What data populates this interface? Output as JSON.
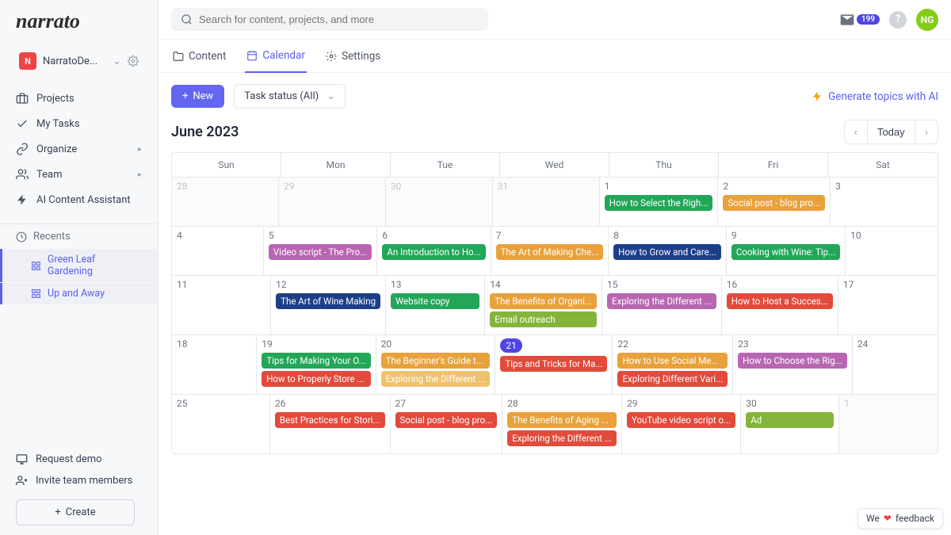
{
  "brand": "narrato",
  "workspace": {
    "badge": "N",
    "name": "NarratoDe..."
  },
  "sidebar": {
    "projects": "Projects",
    "mytasks": "My Tasks",
    "organize": "Organize",
    "team": "Team",
    "ai": "AI Content Assistant",
    "recents_label": "Recents",
    "recents": [
      "Green Leaf Gardening",
      "Up and Away"
    ],
    "request_demo": "Request demo",
    "invite": "Invite team members",
    "create": "Create"
  },
  "search": {
    "placeholder": "Search for content, projects, and more"
  },
  "notifications": {
    "count": "199"
  },
  "avatar": "NG",
  "tabs": {
    "content": "Content",
    "calendar": "Calendar",
    "settings": "Settings"
  },
  "toolbar": {
    "new": "New",
    "filter": "Task status (All)",
    "generate": "Generate topics with AI"
  },
  "calendar": {
    "month": "June 2023",
    "today": "Today",
    "dow": [
      "Sun",
      "Mon",
      "Tue",
      "Wed",
      "Thu",
      "Fri",
      "Sat"
    ],
    "colors": {
      "green": "#22a658",
      "lgreen": "#84b53a",
      "amber": "#e9a13b",
      "lamber": "#eec26c",
      "red": "#e24a3b",
      "navy": "#1d3f8a",
      "purple": "#b865b2"
    },
    "weeks": [
      [
        {
          "n": "28",
          "out": true,
          "events": []
        },
        {
          "n": "29",
          "out": true,
          "events": []
        },
        {
          "n": "30",
          "out": true,
          "events": []
        },
        {
          "n": "31",
          "out": true,
          "events": []
        },
        {
          "n": "1",
          "events": [
            {
              "t": "How to Select the Righ...",
              "c": "green"
            }
          ]
        },
        {
          "n": "2",
          "events": [
            {
              "t": "Social post - blog pro...",
              "c": "amber"
            }
          ]
        },
        {
          "n": "3",
          "events": []
        }
      ],
      [
        {
          "n": "4",
          "events": []
        },
        {
          "n": "5",
          "events": [
            {
              "t": "Video script - The Pro...",
              "c": "purple"
            }
          ]
        },
        {
          "n": "6",
          "events": [
            {
              "t": "An Introduction to Ho...",
              "c": "green"
            }
          ]
        },
        {
          "n": "7",
          "events": [
            {
              "t": "The Art of Making Che...",
              "c": "amber"
            }
          ]
        },
        {
          "n": "8",
          "events": [
            {
              "t": "How to Grow and Care...",
              "c": "navy"
            }
          ]
        },
        {
          "n": "9",
          "events": [
            {
              "t": "Cooking with Wine: Tip...",
              "c": "green"
            }
          ]
        },
        {
          "n": "10",
          "events": []
        }
      ],
      [
        {
          "n": "11",
          "events": []
        },
        {
          "n": "12",
          "events": [
            {
              "t": "The Art of Wine Making",
              "c": "navy"
            }
          ]
        },
        {
          "n": "13",
          "events": [
            {
              "t": "Website copy",
              "c": "green"
            }
          ]
        },
        {
          "n": "14",
          "events": [
            {
              "t": "The Benefits of Organi...",
              "c": "amber"
            },
            {
              "t": "Email outreach",
              "c": "lgreen"
            }
          ]
        },
        {
          "n": "15",
          "events": [
            {
              "t": "Exploring the Different ...",
              "c": "purple"
            }
          ]
        },
        {
          "n": "16",
          "events": [
            {
              "t": "How to Host a Succes...",
              "c": "red"
            }
          ]
        },
        {
          "n": "17",
          "events": []
        }
      ],
      [
        {
          "n": "18",
          "events": []
        },
        {
          "n": "19",
          "events": [
            {
              "t": "Tips for Making Your O...",
              "c": "green"
            },
            {
              "t": "How to Properly Store ...",
              "c": "red"
            }
          ]
        },
        {
          "n": "20",
          "events": [
            {
              "t": "The Beginner's Guide t...",
              "c": "amber"
            },
            {
              "t": "Exploring the Different ...",
              "c": "lamber"
            }
          ]
        },
        {
          "n": "21",
          "today": true,
          "events": [
            {
              "t": "Tips and Tricks for Ma...",
              "c": "red"
            }
          ]
        },
        {
          "n": "22",
          "events": [
            {
              "t": "How to Use Social Me...",
              "c": "amber"
            },
            {
              "t": "Exploring Different Vari...",
              "c": "red"
            }
          ]
        },
        {
          "n": "23",
          "events": [
            {
              "t": "How to Choose the Rig...",
              "c": "purple"
            }
          ]
        },
        {
          "n": "24",
          "events": []
        }
      ],
      [
        {
          "n": "25",
          "events": []
        },
        {
          "n": "26",
          "events": [
            {
              "t": "Best Practices for Stori...",
              "c": "red"
            }
          ]
        },
        {
          "n": "27",
          "events": [
            {
              "t": "Social post - blog pro...",
              "c": "red"
            }
          ]
        },
        {
          "n": "28",
          "events": [
            {
              "t": "The Benefits of Aging ...",
              "c": "amber"
            },
            {
              "t": "Exploring the Different ...",
              "c": "red"
            }
          ]
        },
        {
          "n": "29",
          "events": [
            {
              "t": "YouTube video script o...",
              "c": "red"
            }
          ]
        },
        {
          "n": "30",
          "events": [
            {
              "t": "Ad",
              "c": "lgreen"
            }
          ]
        },
        {
          "n": "1",
          "out": true,
          "events": []
        }
      ]
    ]
  },
  "feedback": {
    "we": "We",
    "text": "feedback"
  }
}
